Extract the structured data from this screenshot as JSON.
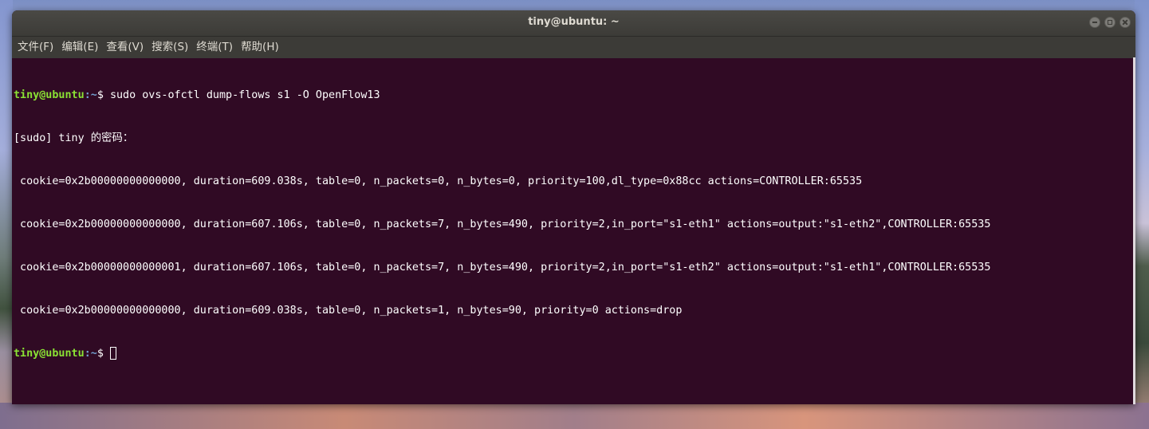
{
  "window": {
    "title": "tiny@ubuntu: ~",
    "controls": [
      "minimize-icon",
      "maximize-icon",
      "close-icon"
    ]
  },
  "menubar": {
    "items": [
      {
        "label": "文件(F)"
      },
      {
        "label": "编辑(E)"
      },
      {
        "label": "查看(V)"
      },
      {
        "label": "搜索(S)"
      },
      {
        "label": "终端(T)"
      },
      {
        "label": "帮助(H)"
      }
    ]
  },
  "terminal": {
    "prompt_user": "tiny@ubuntu",
    "prompt_path": ":~",
    "prompt_symbol": "$ ",
    "command": "sudo ovs-ofctl dump-flows s1 -O OpenFlow13",
    "sudo_prompt": "[sudo] tiny 的密码：",
    "output_lines": [
      " cookie=0x2b00000000000000, duration=609.038s, table=0, n_packets=0, n_bytes=0, priority=100,dl_type=0x88cc actions=CONTROLLER:65535",
      " cookie=0x2b00000000000000, duration=607.106s, table=0, n_packets=7, n_bytes=490, priority=2,in_port=\"s1-eth1\" actions=output:\"s1-eth2\",CONTROLLER:65535",
      " cookie=0x2b00000000000001, duration=607.106s, table=0, n_packets=7, n_bytes=490, priority=2,in_port=\"s1-eth2\" actions=output:\"s1-eth1\",CONTROLLER:65535",
      " cookie=0x2b00000000000000, duration=609.038s, table=0, n_packets=1, n_bytes=90, priority=0 actions=drop"
    ],
    "final_prompt_symbol": "$ "
  },
  "colors": {
    "terminal_bg": "#300a24",
    "prompt_user": "#8ae234",
    "prompt_path": "#729fcf",
    "text": "#ffffff",
    "titlebar": "#3c3b37"
  }
}
